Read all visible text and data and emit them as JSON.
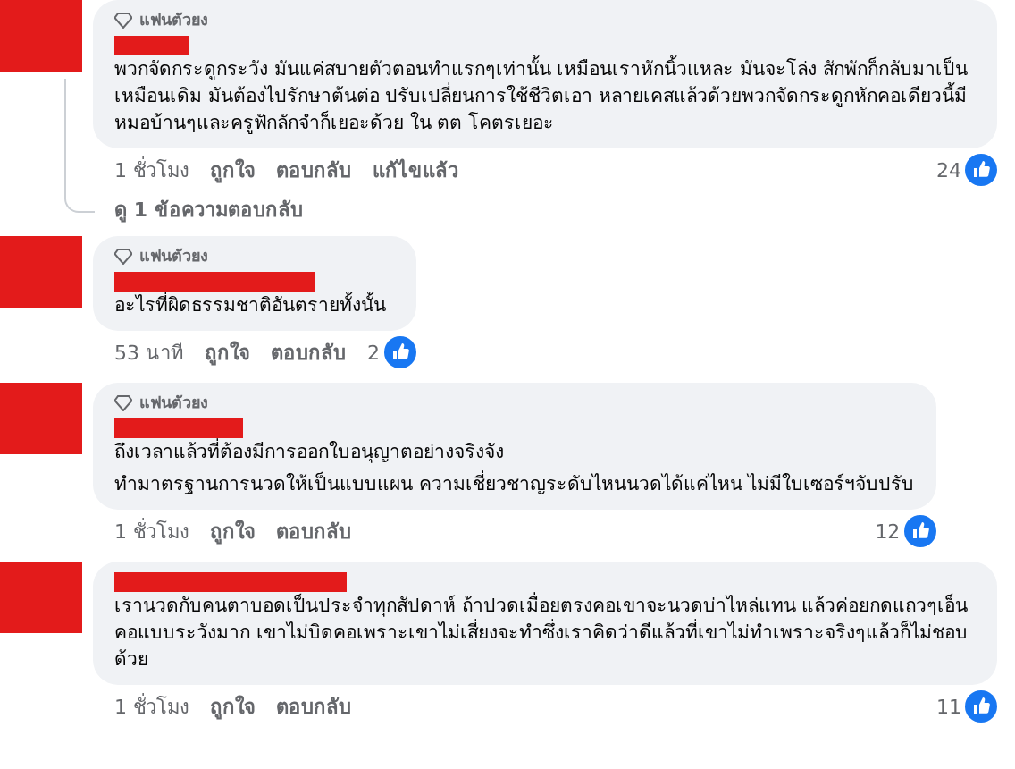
{
  "comments": [
    {
      "badge": "แฟนตัวยง",
      "paragraphs": [
        "พวกจัดกระดูกระวัง มันแค่สบายตัวตอนทำแรกๆเท่านั้น เหมือนเราหักนิ้วแหละ มันจะโล่ง สักพักก็กลับมาเป็นเหมือนเดิม มันต้องไปรักษาต้นต่อ ปรับเปลี่ยนการใช้ชีวิตเอา หลายเคสแล้วด้วยพวกจัดกระดูกหักคอเดียวนี้มีหมอบ้านๆและครูฟักลักจำก็เยอะด้วย ใน ตต โคตรเยอะ"
      ],
      "time": "1 ชั่วโมง",
      "actions": [
        "ถูกใจ",
        "ตอบกลับ",
        "แก้ไขแล้ว"
      ],
      "likes": "24",
      "replies": "ดู 1 ข้อความตอบกลับ"
    },
    {
      "badge": "แฟนตัวยง",
      "paragraphs": [
        "อะไรที่ผิดธรรมชาติอันตรายทั้งนั้น"
      ],
      "time": "53 นาที",
      "actions": [
        "ถูกใจ",
        "ตอบกลับ"
      ],
      "likes": "2"
    },
    {
      "badge": "แฟนตัวยง",
      "paragraphs": [
        "ถึงเวลาแล้วที่ต้องมีการออกใบอนุญาตอย่างจริงจัง",
        "ทำมาตรฐานการนวดให้เป็นแบบแผน ความเชี่ยวชาญระดับไหนนวดได้แค่ไหน ไม่มีใบเซอร์ฯจับปรับ"
      ],
      "time": "1 ชั่วโมง",
      "actions": [
        "ถูกใจ",
        "ตอบกลับ"
      ],
      "likes": "12"
    },
    {
      "paragraphs": [
        "เรานวดกับคนตาบอดเป็นประจำทุกสัปดาห์ ถ้าปวดเมื่อยตรงคอเขาจะนวดบ่าไหล่แทน แล้วค่อยกดแถวๆเอ็นคอแบบระวังมาก เขาไม่บิดคอเพราะเขาไม่เสี่ยงจะทำซึ่งเราคิดว่าดีแล้วที่เขาไม่ทำเพราะจริงๆแล้วก็ไม่ชอบด้วย"
      ],
      "time": "1 ชั่วโมง",
      "actions": [
        "ถูกใจ",
        "ตอบกลับ"
      ],
      "likes": "11"
    }
  ]
}
